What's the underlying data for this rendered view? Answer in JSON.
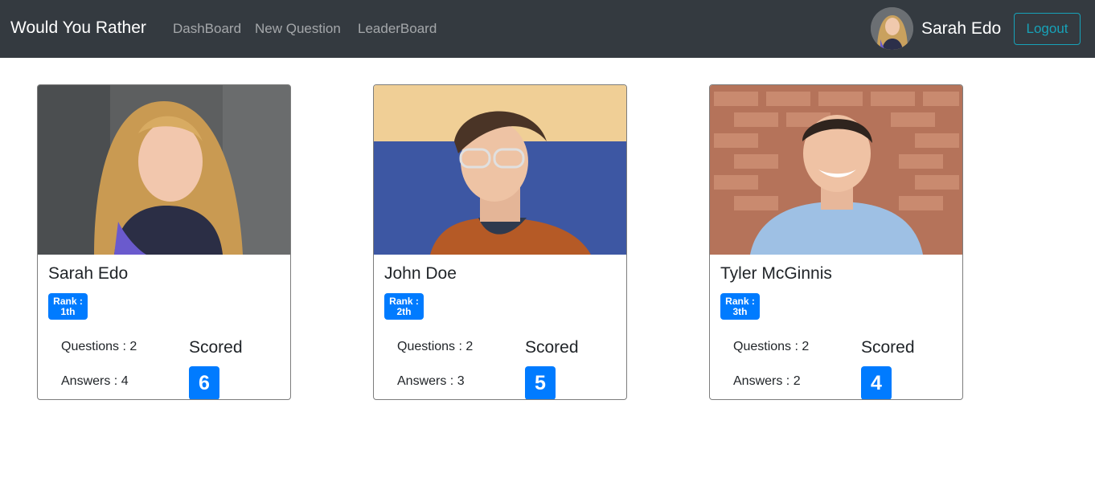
{
  "navbar": {
    "brand": "Would You Rather",
    "links": [
      {
        "label": "DashBoard"
      },
      {
        "label": "New Question"
      },
      {
        "label": "LeaderBoard"
      }
    ],
    "current_user": "Sarah Edo",
    "logout_label": "Logout"
  },
  "leaderboard": {
    "cards": [
      {
        "name": "Sarah Edo",
        "rank_label": "Rank :",
        "rank_value": "1th",
        "questions": "Questions : 2",
        "answers": "Answers : 4",
        "scored_label": "Scored",
        "score": "6"
      },
      {
        "name": "John Doe",
        "rank_label": "Rank :",
        "rank_value": "2th",
        "questions": "Questions : 2",
        "answers": "Answers : 3",
        "scored_label": "Scored",
        "score": "5"
      },
      {
        "name": "Tyler McGinnis",
        "rank_label": "Rank :",
        "rank_value": "3th",
        "questions": "Questions : 2",
        "answers": "Answers : 2",
        "scored_label": "Scored",
        "score": "4"
      }
    ]
  },
  "colors": {
    "navbar_bg": "#343a40",
    "primary": "#007bff",
    "info": "#17a2b8"
  }
}
